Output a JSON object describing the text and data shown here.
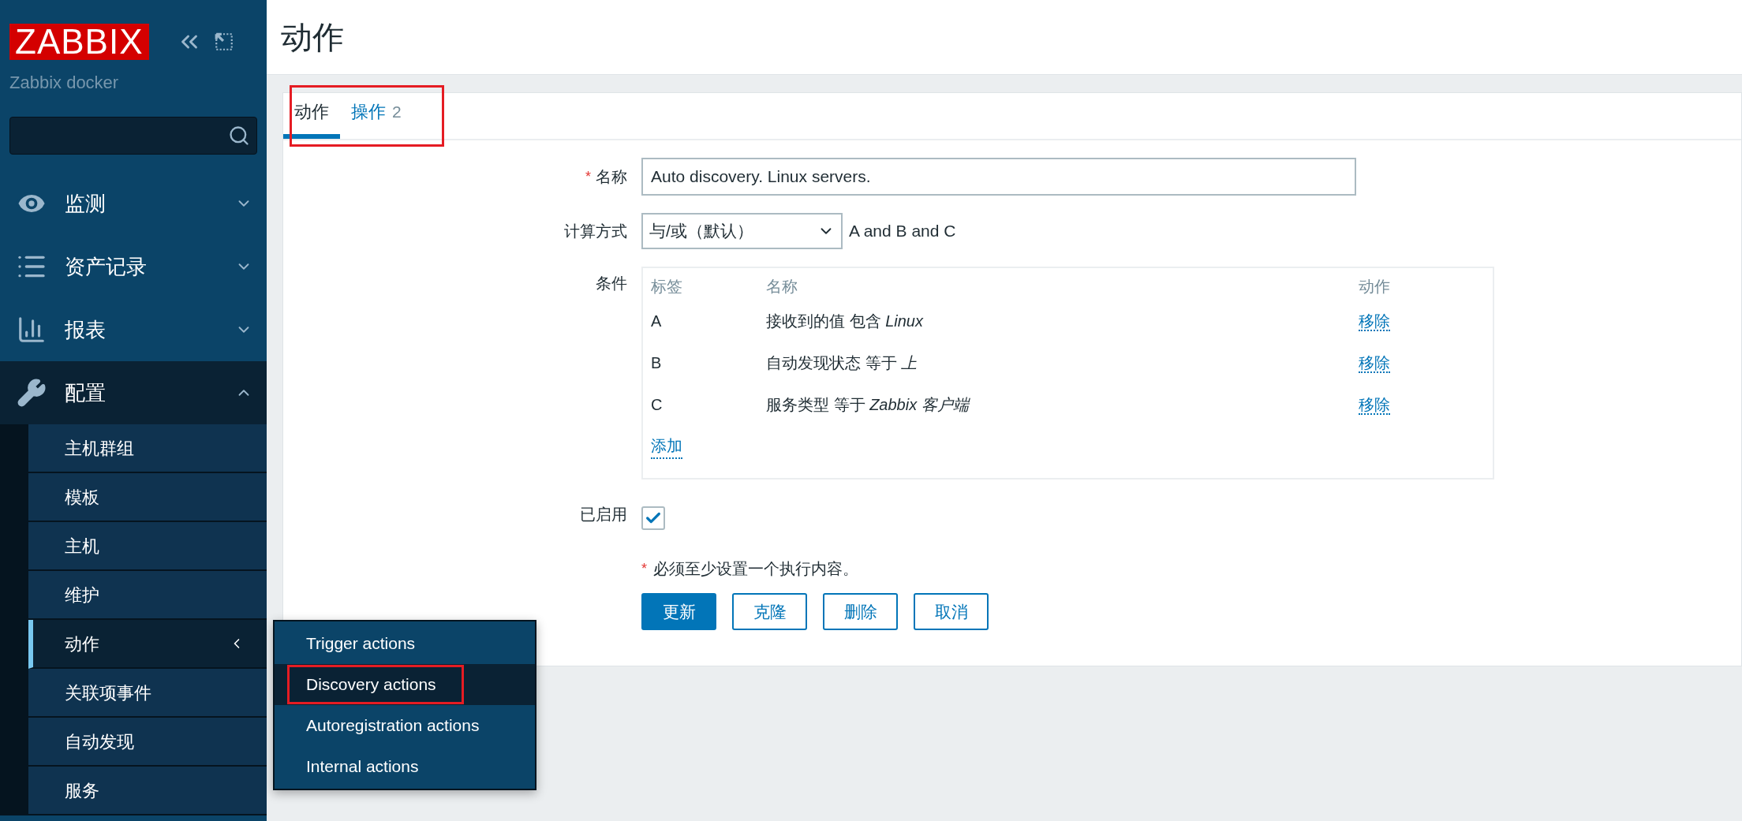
{
  "sidebar": {
    "logo": "ZABBIX",
    "server": "Zabbix docker",
    "menu": [
      {
        "label": "监测",
        "expanded": false
      },
      {
        "label": "资产记录",
        "expanded": false
      },
      {
        "label": "报表",
        "expanded": false
      },
      {
        "label": "配置",
        "expanded": true,
        "children": [
          {
            "label": "主机群组",
            "selected": false
          },
          {
            "label": "模板",
            "selected": false
          },
          {
            "label": "主机",
            "selected": false
          },
          {
            "label": "维护",
            "selected": false
          },
          {
            "label": "动作",
            "selected": true,
            "flyout": [
              {
                "label": "Trigger actions",
                "selected": false,
                "highlighted": false
              },
              {
                "label": "Discovery actions",
                "selected": true,
                "highlighted": true
              },
              {
                "label": "Autoregistration actions",
                "selected": false,
                "highlighted": false
              },
              {
                "label": "Internal actions",
                "selected": false,
                "highlighted": false
              }
            ]
          },
          {
            "label": "关联项事件",
            "selected": false
          },
          {
            "label": "自动发现",
            "selected": false
          },
          {
            "label": "服务",
            "selected": false
          }
        ]
      }
    ]
  },
  "page": {
    "title": "动作",
    "tabs": [
      {
        "label": "动作",
        "selected": true
      },
      {
        "label": "操作",
        "count": "2",
        "selected": false
      }
    ],
    "tabs_highlighted": true,
    "form": {
      "name": {
        "label": "名称",
        "required_mark": "*",
        "value": "Auto discovery. Linux servers."
      },
      "calculation": {
        "label": "计算方式",
        "value": "与/或（默认）",
        "formula": "A and B and C"
      },
      "conditions": {
        "label": "条件",
        "columns": [
          "标签",
          "名称",
          "动作"
        ],
        "rows": [
          {
            "label": "A",
            "name": "接收到的值 包含 *Linux*",
            "action": "移除"
          },
          {
            "label": "B",
            "name": "自动发现状态 等于 *上*",
            "action": "移除"
          },
          {
            "label": "C",
            "name": "服务类型 等于 *Zabbix 客户端*",
            "action": "移除"
          }
        ],
        "add": "添加"
      },
      "enabled": {
        "label": "已启用",
        "checked": true
      },
      "note": {
        "required_mark": "*",
        "text": "必须至少设置一个执行内容。"
      },
      "buttons": [
        {
          "label": "更新",
          "primary": true
        },
        {
          "label": "克隆",
          "primary": false
        },
        {
          "label": "删除",
          "primary": false
        },
        {
          "label": "取消",
          "primary": false
        }
      ]
    }
  }
}
